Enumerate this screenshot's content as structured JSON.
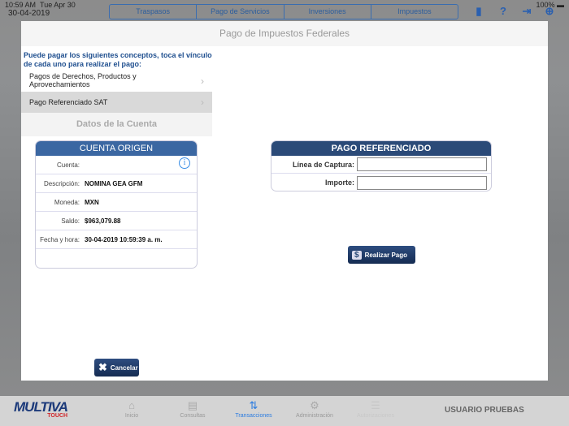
{
  "status": {
    "time": "10:59 AM",
    "day": "Tue Apr 30",
    "date": "30-04-2019",
    "battery": "100%"
  },
  "segments": [
    "Traspasos",
    "Pago de Servicios",
    "Inversiones",
    "Impuestos"
  ],
  "modal": {
    "title": "Pago de Impuestos Federales",
    "intro": "Puede pagar los siguientes conceptos, toca el vínculo de cada uno para realizar el pago:",
    "options": [
      {
        "label": "Pagos de Derechos, Productos y Aprovechamientos"
      },
      {
        "label": "Pago Referenciado SAT"
      }
    ],
    "datos_title": "Datos de la Cuenta",
    "cuenta": {
      "title": "CUENTA ORIGEN",
      "rows": [
        {
          "label": "Cuenta:",
          "value": ""
        },
        {
          "label": "Descripción:",
          "value": "NOMINA GEA GFM"
        },
        {
          "label": "Moneda:",
          "value": "MXN"
        },
        {
          "label": "Saldo:",
          "value": "$963,079.88"
        },
        {
          "label": "Fecha y hora:",
          "value": "30-04-2019 10:59:39 a. m."
        }
      ]
    },
    "pago": {
      "title": "PAGO REFERENCIADO",
      "linea_label": "Línea de Captura:",
      "linea_value": "",
      "importe_label": "Importe:",
      "importe_value": ""
    },
    "realizar": "Realizar Pago",
    "cancelar": "Cancelar"
  },
  "tabbar": {
    "brand": "MULTIVA",
    "brand_sub": "TOUCH",
    "tabs": [
      {
        "label": "Inicio"
      },
      {
        "label": "Consultas"
      },
      {
        "label": "Transacciones"
      },
      {
        "label": "Administración"
      },
      {
        "label": "Autorizaciones"
      }
    ],
    "user": "USUARIO PRUEBAS"
  }
}
